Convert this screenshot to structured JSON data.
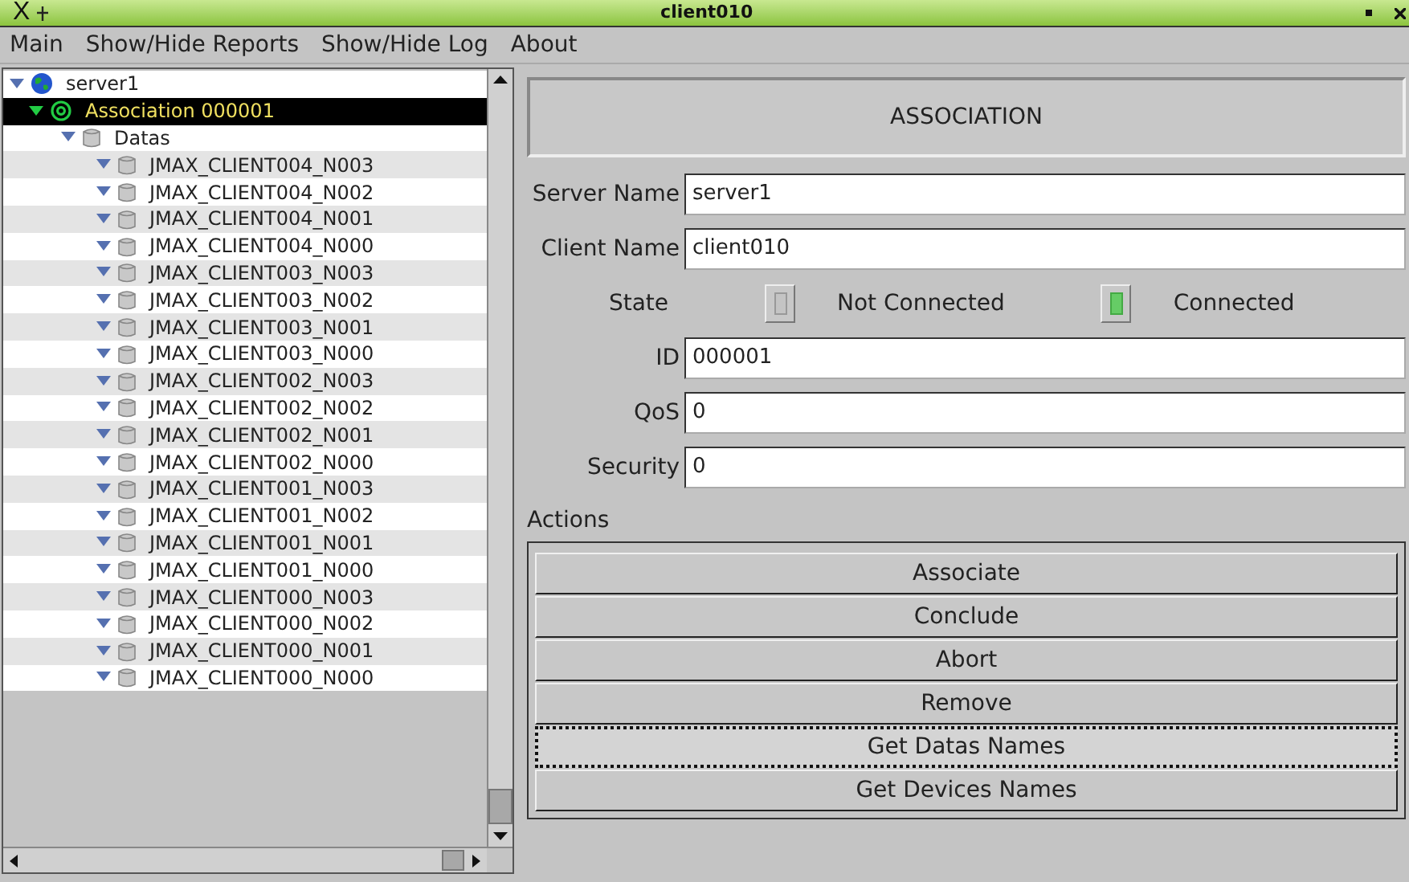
{
  "window": {
    "logo": "X",
    "title": "client010"
  },
  "menu": [
    "Main",
    "Show/Hide Reports",
    "Show/Hide Log",
    "About"
  ],
  "tree": [
    {
      "label": "server1",
      "kind": "server",
      "expanded": true,
      "selected": false,
      "children": [
        {
          "label": "Association 000001",
          "kind": "association",
          "expanded": true,
          "selected": true,
          "children": [
            {
              "label": "Datas",
              "kind": "folder",
              "expanded": true,
              "selected": false,
              "children": [
                {
                  "label": "JMAX_CLIENT004_N003",
                  "kind": "data",
                  "expanded": true,
                  "selected": false
                },
                {
                  "label": "JMAX_CLIENT004_N002",
                  "kind": "data",
                  "expanded": true,
                  "selected": false
                },
                {
                  "label": "JMAX_CLIENT004_N001",
                  "kind": "data",
                  "expanded": true,
                  "selected": false
                },
                {
                  "label": "JMAX_CLIENT004_N000",
                  "kind": "data",
                  "expanded": true,
                  "selected": false
                },
                {
                  "label": "JMAX_CLIENT003_N003",
                  "kind": "data",
                  "expanded": true,
                  "selected": false
                },
                {
                  "label": "JMAX_CLIENT003_N002",
                  "kind": "data",
                  "expanded": true,
                  "selected": false
                },
                {
                  "label": "JMAX_CLIENT003_N001",
                  "kind": "data",
                  "expanded": true,
                  "selected": false
                },
                {
                  "label": "JMAX_CLIENT003_N000",
                  "kind": "data",
                  "expanded": true,
                  "selected": false
                },
                {
                  "label": "JMAX_CLIENT002_N003",
                  "kind": "data",
                  "expanded": true,
                  "selected": false
                },
                {
                  "label": "JMAX_CLIENT002_N002",
                  "kind": "data",
                  "expanded": true,
                  "selected": false
                },
                {
                  "label": "JMAX_CLIENT002_N001",
                  "kind": "data",
                  "expanded": true,
                  "selected": false
                },
                {
                  "label": "JMAX_CLIENT002_N000",
                  "kind": "data",
                  "expanded": true,
                  "selected": false
                },
                {
                  "label": "JMAX_CLIENT001_N003",
                  "kind": "data",
                  "expanded": true,
                  "selected": false
                },
                {
                  "label": "JMAX_CLIENT001_N002",
                  "kind": "data",
                  "expanded": true,
                  "selected": false
                },
                {
                  "label": "JMAX_CLIENT001_N001",
                  "kind": "data",
                  "expanded": true,
                  "selected": false
                },
                {
                  "label": "JMAX_CLIENT001_N000",
                  "kind": "data",
                  "expanded": true,
                  "selected": false
                },
                {
                  "label": "JMAX_CLIENT000_N003",
                  "kind": "data",
                  "expanded": true,
                  "selected": false
                },
                {
                  "label": "JMAX_CLIENT000_N002",
                  "kind": "data",
                  "expanded": true,
                  "selected": false
                },
                {
                  "label": "JMAX_CLIENT000_N001",
                  "kind": "data",
                  "expanded": true,
                  "selected": false
                },
                {
                  "label": "JMAX_CLIENT000_N000",
                  "kind": "data",
                  "expanded": true,
                  "selected": false
                }
              ]
            }
          ]
        }
      ]
    }
  ],
  "panel": {
    "heading": "ASSOCIATION",
    "fields_top": [
      {
        "label": "Server Name",
        "value": "server1"
      },
      {
        "label": "Client Name",
        "value": "client010"
      }
    ],
    "state": {
      "label": "State",
      "indicators": [
        {
          "label": "Not Connected",
          "on": false
        },
        {
          "label": "Connected",
          "on": true
        }
      ]
    },
    "fields_bottom": [
      {
        "label": "ID",
        "value": "000001"
      },
      {
        "label": "QoS",
        "value": "0"
      },
      {
        "label": "Security",
        "value": "0"
      }
    ],
    "actions_label": "Actions",
    "actions": [
      {
        "label": "Associate",
        "focused": false
      },
      {
        "label": "Conclude",
        "focused": false
      },
      {
        "label": "Abort",
        "focused": false
      },
      {
        "label": "Remove",
        "focused": false
      },
      {
        "label": "Get Datas Names",
        "focused": true
      },
      {
        "label": "Get Devices Names",
        "focused": false
      }
    ]
  }
}
